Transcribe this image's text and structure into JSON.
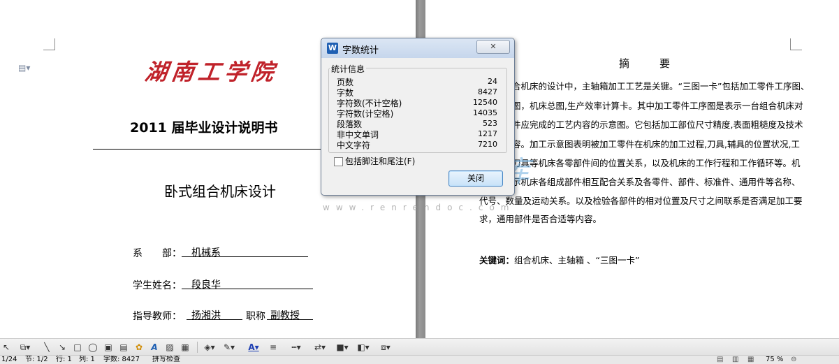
{
  "left_page": {
    "logo_text": "湖南工学院",
    "title": "2011 届毕业设计说明书",
    "subtitle": "卧式组合机床设计",
    "fields": {
      "dept_label": "系　　部：",
      "dept_value": "机械系",
      "student_label": "学生姓名：",
      "student_value": "段良华",
      "advisor_label": "指导教师：",
      "advisor_value": "扬湘洪",
      "rank_label": "职称",
      "rank_value": "副教授"
    }
  },
  "right_page": {
    "heading": "摘　要",
    "lines": [
      "合机床的设计中，主轴箱加工工艺是关键。“三图一卡”包括加工零件工序图、",
      "图，机床总图,生产效率计算卡。其中加工零件工序图是表示一台组合机床对",
      "件应完成的工艺内容的示意图。它包括加工部位尺寸精度,表面粗糙度及技术",
      "容。加工示意图表明被加工零件在机床的加工过程,刀具,辅具的位置状况,工",
      "刀具等机床各零部件间的位置关系，以及机床的工作行程和工作循环等。机",
      "示机床各组成部件相互配合关系及各零件、部件、标准件、通用件等名称、",
      "代号、数量及运动关系。以及检验各部件的相对位置及尺寸之间联系是否满足加工要",
      "求，通用部件是否合适等内容。"
    ],
    "keywords_label": "关键词：",
    "keywords_value": "组合机床、主轴箱 、“三图一卡”"
  },
  "watermark": {
    "text": "人人文库",
    "url": "www.renrendoc.com"
  },
  "dialog": {
    "app_icon": "W",
    "title": "字数统计",
    "group_label": "统计信息",
    "stats": [
      {
        "label": "页数",
        "value": "24"
      },
      {
        "label": "字数",
        "value": "8427"
      },
      {
        "label": "字符数(不计空格)",
        "value": "12540"
      },
      {
        "label": "字符数(计空格)",
        "value": "14035"
      },
      {
        "label": "段落数",
        "value": "523"
      },
      {
        "label": "非中文单词",
        "value": "1217"
      },
      {
        "label": "中文字符",
        "value": "7210"
      }
    ],
    "checkbox_label": "包括脚注和尾注(F)",
    "close_button": "关闭",
    "close_x": "✕"
  },
  "statusbar": {
    "page": "1/24",
    "section": "节: 1/2",
    "row": "行: 1",
    "col": "列: 1",
    "words": "字数: 8427",
    "spell": "拼写检查",
    "zoom": "75 %"
  },
  "colors": {
    "logo": "#c0222a",
    "dialog_accent": "#4b87c4"
  }
}
